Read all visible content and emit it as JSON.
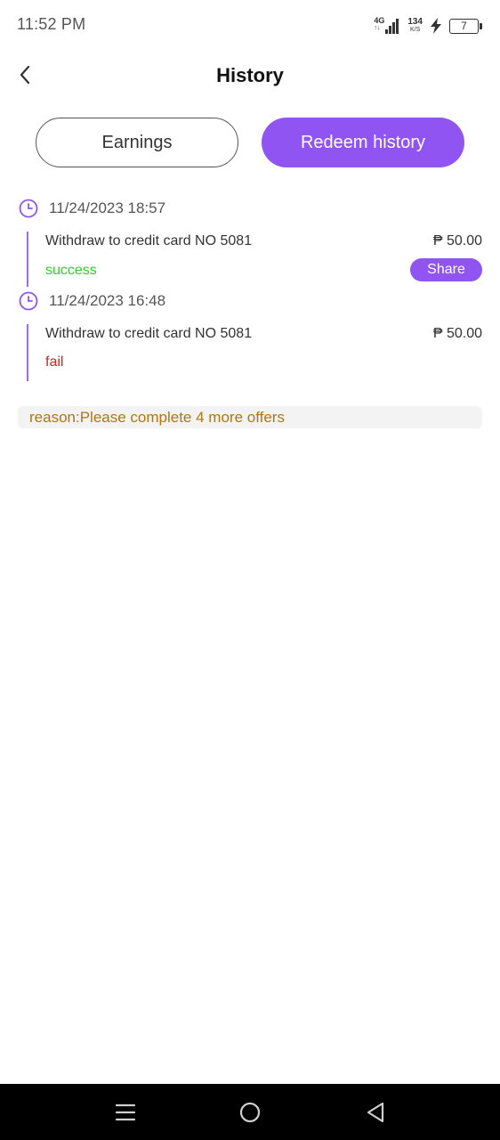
{
  "status_bar": {
    "time": "11:52 PM",
    "network": "4G",
    "network_sub": "↑↓",
    "speed_value": "134",
    "speed_unit": "K/S",
    "battery": "7"
  },
  "header": {
    "title": "History"
  },
  "tabs": [
    {
      "label": "Earnings",
      "active": false
    },
    {
      "label": "Redeem history",
      "active": true
    }
  ],
  "records": [
    {
      "date": "11/24/2023 18:57",
      "description": "Withdraw to credit card NO 5081",
      "amount": "₱ 50.00",
      "status": "success",
      "share_label": "Share"
    },
    {
      "date": "11/24/2023 16:48",
      "description": "Withdraw to credit card NO 5081",
      "amount": "₱ 50.00",
      "status": "fail",
      "reason": "reason:Please complete 4 more offers"
    }
  ],
  "colors": {
    "accent": "#8f54f2",
    "success": "#2ed02e",
    "fail": "#c8281e",
    "reason_text": "#b07612"
  },
  "icons": {
    "back": "back-arrow-icon",
    "clock": "clock-icon",
    "menu": "menu-icon",
    "home": "home-icon",
    "nav_back": "nav-back-icon"
  }
}
